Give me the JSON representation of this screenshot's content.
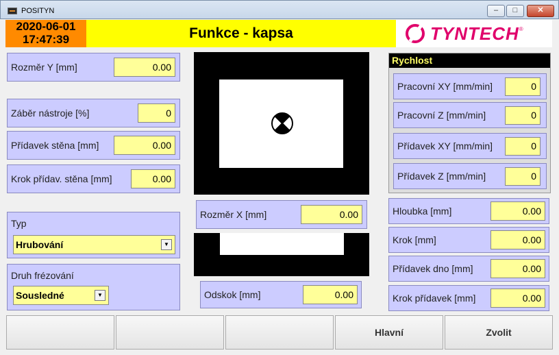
{
  "window": {
    "title": "POSITYN"
  },
  "header": {
    "date": "2020-06-01",
    "time": "17:47:39",
    "title": "Funkce - kapsa",
    "logo_text": "TYNTECH"
  },
  "left": {
    "rozmer_y": {
      "label": "Rozměr Y [mm]",
      "value": "0.00"
    },
    "zaber": {
      "label": "Záběr nástroje [%]",
      "value": "0"
    },
    "pridavek_stena": {
      "label": "Přídavek stěna [mm]",
      "value": "0.00"
    },
    "krok_pridav_stena": {
      "label": "Krok přídav. stěna [mm]",
      "value": "0.00"
    },
    "typ": {
      "label": "Typ",
      "value": "Hrubování"
    },
    "druh": {
      "label": "Druh frézování",
      "value": "Sousledné"
    }
  },
  "center": {
    "rozmer_x": {
      "label": "Rozměr X [mm]",
      "value": "0.00"
    },
    "odskok": {
      "label": "Odskok [mm]",
      "value": "0.00"
    }
  },
  "speed": {
    "title": "Rychlost",
    "items": [
      {
        "label": "Pracovní XY [mm/min]",
        "value": "0"
      },
      {
        "label": "Pracovní Z [mm/min]",
        "value": "0"
      },
      {
        "label": "Přídavek XY [mm/min]",
        "value": "0"
      },
      {
        "label": "Přídavek Z [mm/min]",
        "value": "0"
      }
    ]
  },
  "right": {
    "hloubka": {
      "label": "Hloubka  [mm]",
      "value": "0.00"
    },
    "krok": {
      "label": "Krok [mm]",
      "value": "0.00"
    },
    "pridavek_dno": {
      "label": "Přídavek dno [mm]",
      "value": "0.00"
    },
    "krok_pridavek": {
      "label": "Krok přídavek [mm]",
      "value": "0.00"
    }
  },
  "footer": {
    "buttons": [
      "",
      "",
      "",
      "Hlavní",
      "Zvolit"
    ]
  },
  "colors": {
    "datetime_bg": "#ff8a00",
    "header_bg": "#ffff00",
    "panel_bg": "#ccccff",
    "value_bg": "#ffff99",
    "brand": "#e0006b"
  }
}
